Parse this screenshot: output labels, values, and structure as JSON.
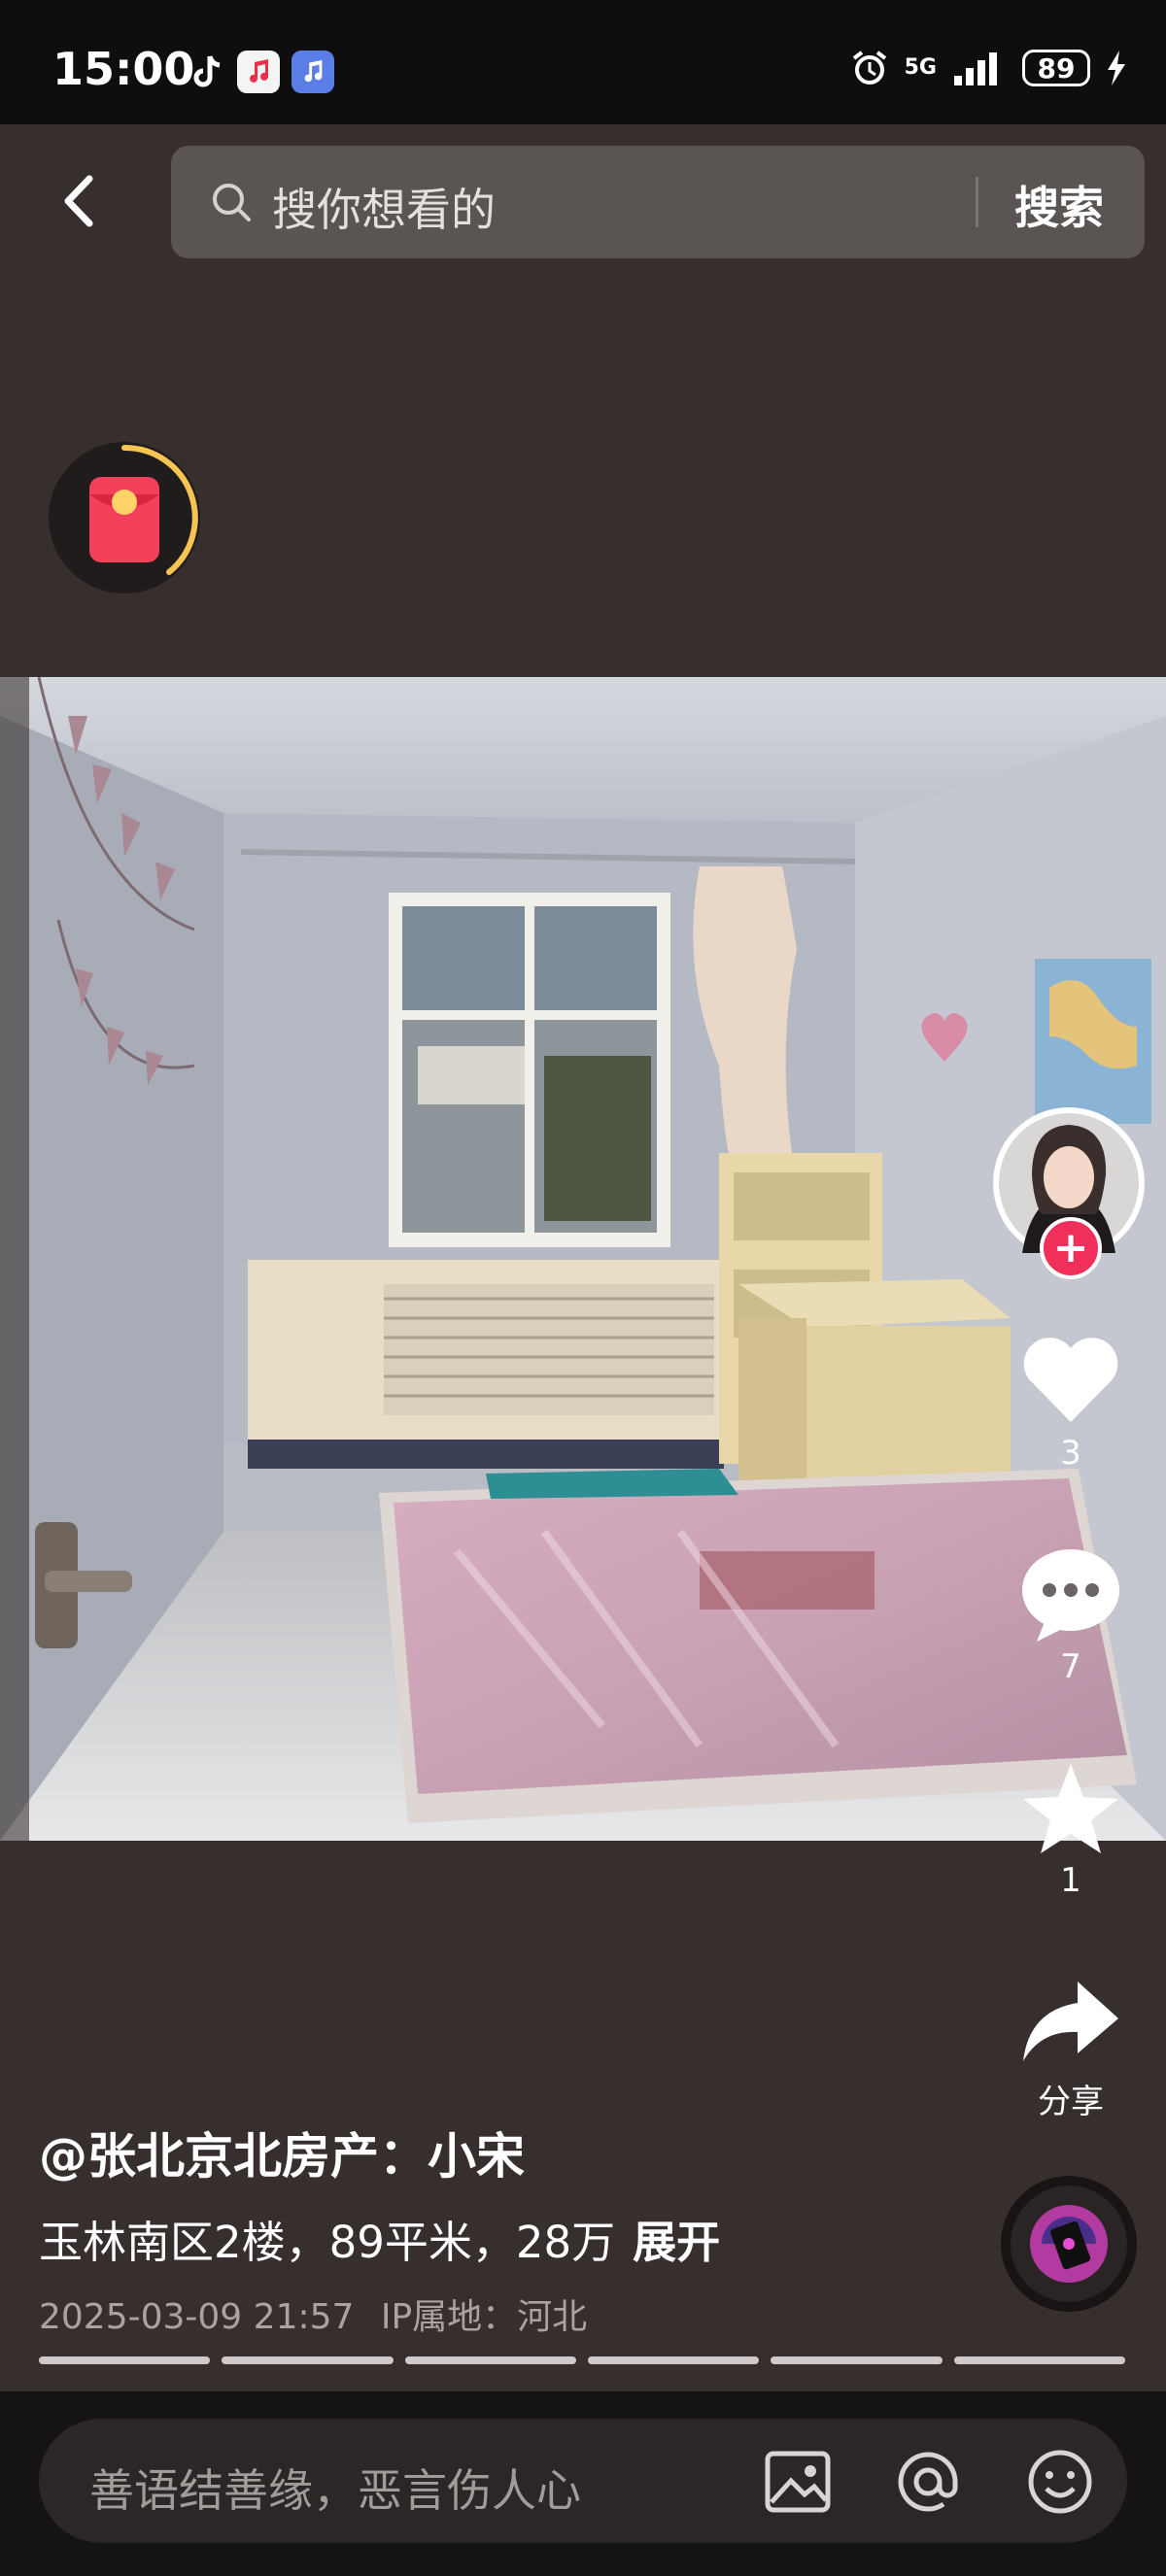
{
  "status_bar": {
    "time": "15:00",
    "network": "5G",
    "battery": "89"
  },
  "search": {
    "placeholder": "搜你想看的",
    "button_label": "搜索"
  },
  "photo": {
    "description_icon": "bedroom-photo"
  },
  "sidebar": {
    "like_count": "3",
    "comment_count": "7",
    "favorite_count": "1",
    "share_label": "分享",
    "follow_symbol": "+"
  },
  "post": {
    "author": "@张北京北房产：小宋",
    "description": "玉林南区2楼，89平米，28万",
    "expand_label": "展开",
    "timestamp": "2025-03-09 21:57",
    "ip_location": "IP属地：河北"
  },
  "carousel": {
    "slides": 6,
    "active_slide": 6
  },
  "comment_bar": {
    "placeholder": "善语结善缘，恶言伤人心"
  },
  "colors": {
    "background": "#372f2e",
    "follow": "#f0305a",
    "redpacket": "#f2405a"
  }
}
